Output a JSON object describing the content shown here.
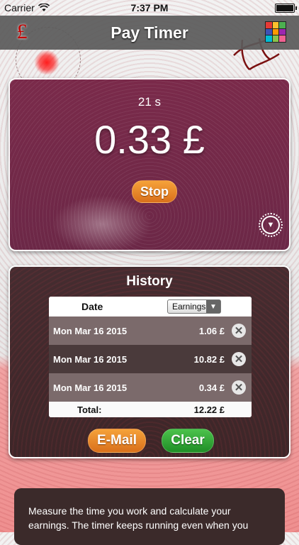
{
  "status_bar": {
    "carrier": "Carrier",
    "time": "7:37 PM"
  },
  "navbar": {
    "title": "Pay Timer",
    "left_icon": "pound-icon",
    "right_icon": "color-grid-icon",
    "grid_colors": [
      "#e53935",
      "#fbc02d",
      "#4caf50",
      "#3f51b5",
      "#ff9800",
      "#9c27b0",
      "#00bcd4",
      "#8bc34a",
      "#f06292"
    ]
  },
  "timer": {
    "seconds_label": "21 s",
    "amount": "0.33 £",
    "stop_label": "Stop",
    "settings_icon": "gear-icon"
  },
  "history": {
    "title": "History",
    "columns": {
      "date": "Date",
      "sort_selected": "Earnings"
    },
    "rows": [
      {
        "date": "Mon Mar 16 2015",
        "earnings": "1.06 £"
      },
      {
        "date": "Mon Mar 16 2015",
        "earnings": "10.82 £"
      },
      {
        "date": "Mon Mar 16 2015",
        "earnings": "0.34 £"
      }
    ],
    "total_label": "Total:",
    "total_value": "12.22 £",
    "email_label": "E-Mail",
    "clear_label": "Clear"
  },
  "info": {
    "text": "Measure the time you work and calculate your earnings. The timer keeps running even when you"
  },
  "colors": {
    "navbar": "#5a5a5a",
    "timer_panel": "#74294a",
    "history_panel": "#422a2d",
    "orange_button": "#e8862a",
    "green_button": "#2ea535",
    "pound_red": "#c40000"
  }
}
